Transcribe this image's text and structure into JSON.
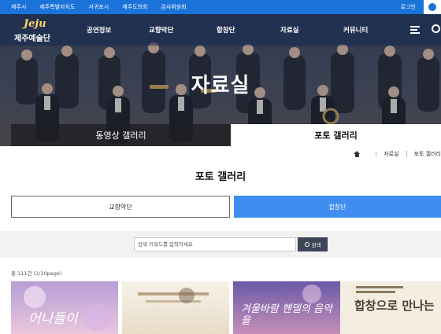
{
  "topbar": {
    "links": [
      "제주시",
      "제주특별자치도",
      "서귀포시",
      "제주도의회",
      "감사위원회"
    ],
    "login": "로그인"
  },
  "logo": {
    "script": "Jeju",
    "name": "제주예술단"
  },
  "nav": {
    "items": [
      "공연정보",
      "교향악단",
      "합창단",
      "자료실",
      "커뮤니티"
    ]
  },
  "hero": {
    "title": "자료실"
  },
  "subtabs": {
    "video": "동영상 갤러리",
    "photo": "포토 갤러리"
  },
  "breadcrumb": {
    "items": [
      "자료실",
      "포토 갤러리"
    ]
  },
  "page_title": "포토 갤러리",
  "categories": {
    "orchestra": "교향악단",
    "choir": "합창단"
  },
  "search": {
    "placeholder": "검색 키워드를 입력하세요",
    "button": "검색"
  },
  "count": {
    "text": "총 111건 (1/10page)"
  },
  "gallery": [
    {
      "text": "어나들이"
    },
    {
      "text": ""
    },
    {
      "text": "겨울바람 헨델의 음악을"
    },
    {
      "text": "합창으로 만나는"
    }
  ],
  "colors": {
    "primary": "#1a73d9",
    "accent_button": "#3f8df0",
    "search_button": "#3c4656"
  }
}
